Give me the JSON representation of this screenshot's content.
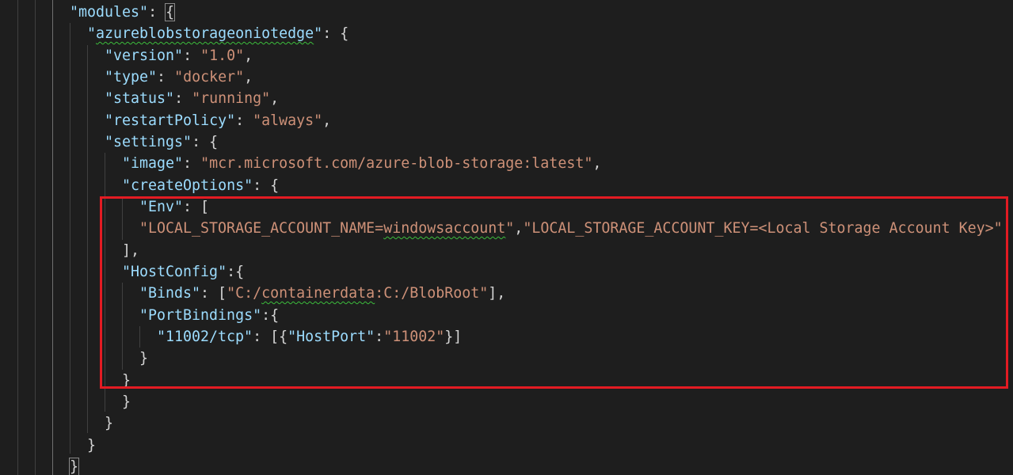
{
  "colors": {
    "background": "#1e1e1e",
    "property_key": "#9cdcfe",
    "string_value": "#ce9178",
    "punctuation": "#d4d4d4",
    "indent_guide": "#404040",
    "squiggle": "#3cbd3c",
    "annotation_box": "#e31b23"
  },
  "code": {
    "l1_key": "\"modules\"",
    "l1_punct": ": ",
    "l1_brace": "{",
    "l2_key_open": "\"",
    "l2_key_word": "azureblobstorageoniotedge",
    "l2_key_close": "\"",
    "l2_punct": ": {",
    "l3_key": "\"version\"",
    "l3_punct": ": ",
    "l3_val": "\"1.0\"",
    "l3_end": ",",
    "l4_key": "\"type\"",
    "l4_punct": ": ",
    "l4_val": "\"docker\"",
    "l4_end": ",",
    "l5_key": "\"status\"",
    "l5_punct": ": ",
    "l5_val": "\"running\"",
    "l5_end": ",",
    "l6_key": "\"restartPolicy\"",
    "l6_punct": ": ",
    "l6_val": "\"always\"",
    "l6_end": ",",
    "l7_key": "\"settings\"",
    "l7_punct": ": {",
    "l8_key": "\"image\"",
    "l8_punct": ": ",
    "l8_val": "\"mcr.microsoft.com/azure-blob-storage:latest\"",
    "l8_end": ",",
    "l9_key": "\"createOptions\"",
    "l9_punct": ": {",
    "l10_key": "\"Env\"",
    "l10_punct": ": [",
    "l11_val_a": "\"LOCAL_STORAGE_ACCOUNT_NAME=",
    "l11_val_b": "windowsaccount",
    "l11_val_c": "\"",
    "l11_comma": ",",
    "l11_val_d": "\"LOCAL_STORAGE_ACCOUNT_KEY=<Local Storage Account Key>\"",
    "l12_punct": "],",
    "l13_key": "\"HostConfig\"",
    "l13_punct": ":{",
    "l14_key": "\"Binds\"",
    "l14_punct": ": [",
    "l14_val_a": "\"C:/",
    "l14_val_b": "containerdata",
    "l14_val_c": ":C:/BlobRoot\"",
    "l14_end": "],",
    "l15_key": "\"PortBindings\"",
    "l15_punct": ":{",
    "l16_key": "\"11002/tcp\"",
    "l16_punct": ": [{",
    "l16_key2": "\"HostPort\"",
    "l16_colon": ":",
    "l16_val": "\"11002\"",
    "l16_end": "}]",
    "l17_punct": "}",
    "l18_punct": "}",
    "l19_punct": "}",
    "l20_punct": "}",
    "l21_punct": "}",
    "l22_punct": "}"
  }
}
